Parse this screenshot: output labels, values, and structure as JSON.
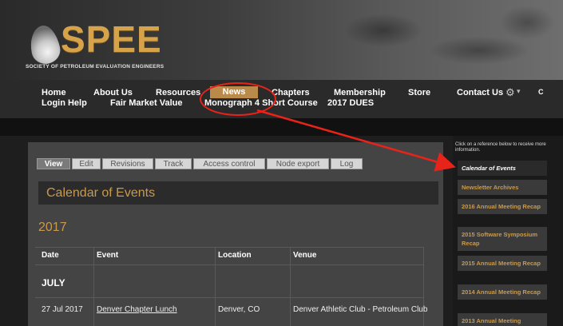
{
  "brand": {
    "logo_text": "SPEE",
    "tagline": "SOCIETY OF PETROLEUM EVALUATION ENGINEERS"
  },
  "nav": {
    "row1": [
      {
        "id": "home",
        "label": "Home"
      },
      {
        "id": "about",
        "label": "About Us"
      },
      {
        "id": "resources",
        "label": "Resources"
      },
      {
        "id": "news",
        "label": "News"
      },
      {
        "id": "chapters",
        "label": "Chapters"
      },
      {
        "id": "membership",
        "label": "Membership"
      },
      {
        "id": "store",
        "label": "Store"
      },
      {
        "id": "contact",
        "label": "Contact Us"
      }
    ],
    "row2": [
      {
        "id": "login-help",
        "label": "Login Help"
      },
      {
        "id": "fair-market",
        "label": "Fair Market Value"
      },
      {
        "id": "monograph",
        "label": "Monograph 4 Short Course"
      },
      {
        "id": "dues",
        "label": "2017 DUES"
      }
    ],
    "gear_icon": "gear-icon",
    "edge_letter": "C"
  },
  "tabs": [
    "View",
    "Edit",
    "Revisions",
    "Track",
    "Access control",
    "Node export",
    "Log"
  ],
  "active_tab": "View",
  "page": {
    "title": "Calendar of Events",
    "year": "2017"
  },
  "table": {
    "headers": [
      "Date",
      "Event",
      "Location",
      "Venue"
    ],
    "month": "JULY",
    "rows": [
      {
        "date": "27 Jul 2017",
        "event": "Denver Chapter Lunch",
        "location": "Denver, CO",
        "venue": "Denver Athletic Club - Petroleum Club"
      }
    ]
  },
  "sidebar": {
    "note": "Click on a reference below to receive more information.",
    "items": [
      {
        "label": "Calendar of Events",
        "active": true
      },
      {
        "label": "Newsletter Archives",
        "active": false
      },
      {
        "label": "2016 Annual Meeting Recap",
        "active": false
      },
      {
        "label": "2015 Software Symposium Recap",
        "active": false
      },
      {
        "label": "2015 Annual Meeting Recap",
        "active": false
      },
      {
        "label": "2014 Annual Meeting Recap",
        "active": false
      },
      {
        "label": "2013 Annual Meeting",
        "active": false
      }
    ]
  },
  "colors": {
    "accent_gold": "#c99a4e",
    "annotation_red": "#e8231a",
    "news_highlight": "#b98a4a"
  }
}
